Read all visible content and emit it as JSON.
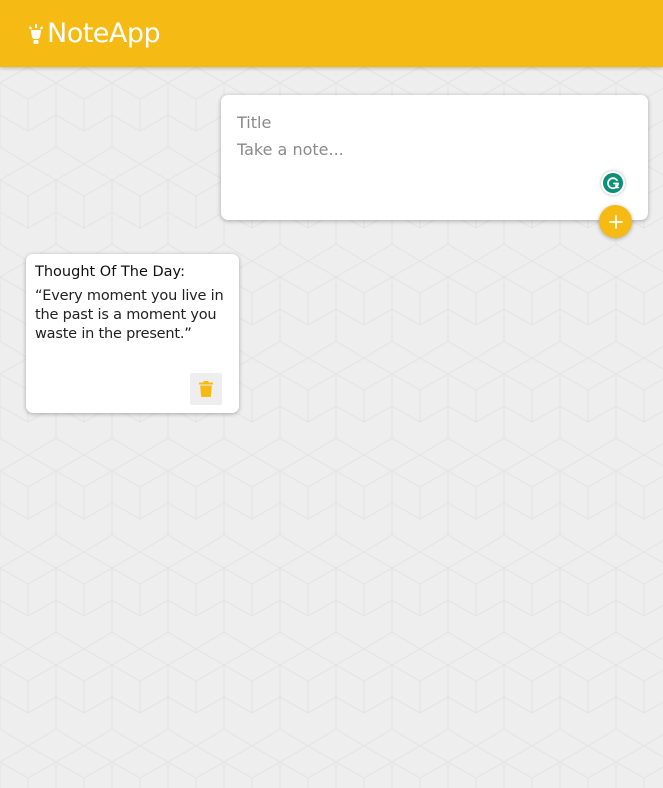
{
  "header": {
    "app_title": "NoteApp",
    "icon": "lightbulb-icon"
  },
  "create_form": {
    "title_placeholder": "Title",
    "content_placeholder": "Take a note...",
    "add_button_icon": "plus-icon",
    "extension_icon": "grammarly-icon"
  },
  "notes": [
    {
      "title": "Thought Of The Day:",
      "content": "“Every moment you live in the past is a moment you waste in the present.”",
      "delete_icon": "trash-icon"
    }
  ],
  "colors": {
    "accent": "#f5ba13",
    "background": "#eeeeee",
    "card": "#ffffff",
    "grammarly": "#0b8f79"
  }
}
